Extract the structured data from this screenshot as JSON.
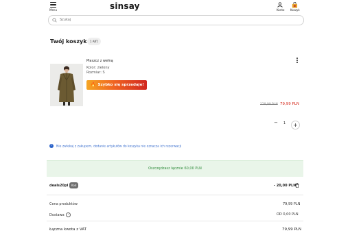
{
  "header": {
    "menu_label": "Menu",
    "logo": "sinsay",
    "account_label": "Konto",
    "cart_label": "Koszyk"
  },
  "search": {
    "placeholder": "Szukaj"
  },
  "cart": {
    "title": "Twój koszyk",
    "count": "1 ART."
  },
  "product": {
    "name": "Płaszcz z wełną",
    "color": "Kolor: zielony",
    "size": "Rozmiar: S",
    "badge": "Szybko się sprzedaje!",
    "old_price": "129,99 PLN",
    "new_price": "79,99 PLN",
    "quantity": "1"
  },
  "info_message": "Nie zwlekaj z zakupem, dodanie artykułów do koszyka nie oznacza ich rezerwacji",
  "savings": "Oszczędzasz łącznie 60,00 PLN",
  "coupon": {
    "code": "deals20pl",
    "tag": "Kod",
    "amount": "- 20,00 PLN"
  },
  "summary": {
    "products_label": "Cena produktów",
    "products_value": "79,99 PLN",
    "delivery_label": "Dostawa",
    "delivery_value": "OD 0,00 PLN",
    "total_label": "Łączna kwota z VAT",
    "total_value": "79,99 PLN"
  },
  "colors": {
    "price_red": "#d52b1e",
    "info_blue": "#2b63c9",
    "savings_green": "#2e8b3a",
    "savings_bg": "#e9f5e9"
  }
}
